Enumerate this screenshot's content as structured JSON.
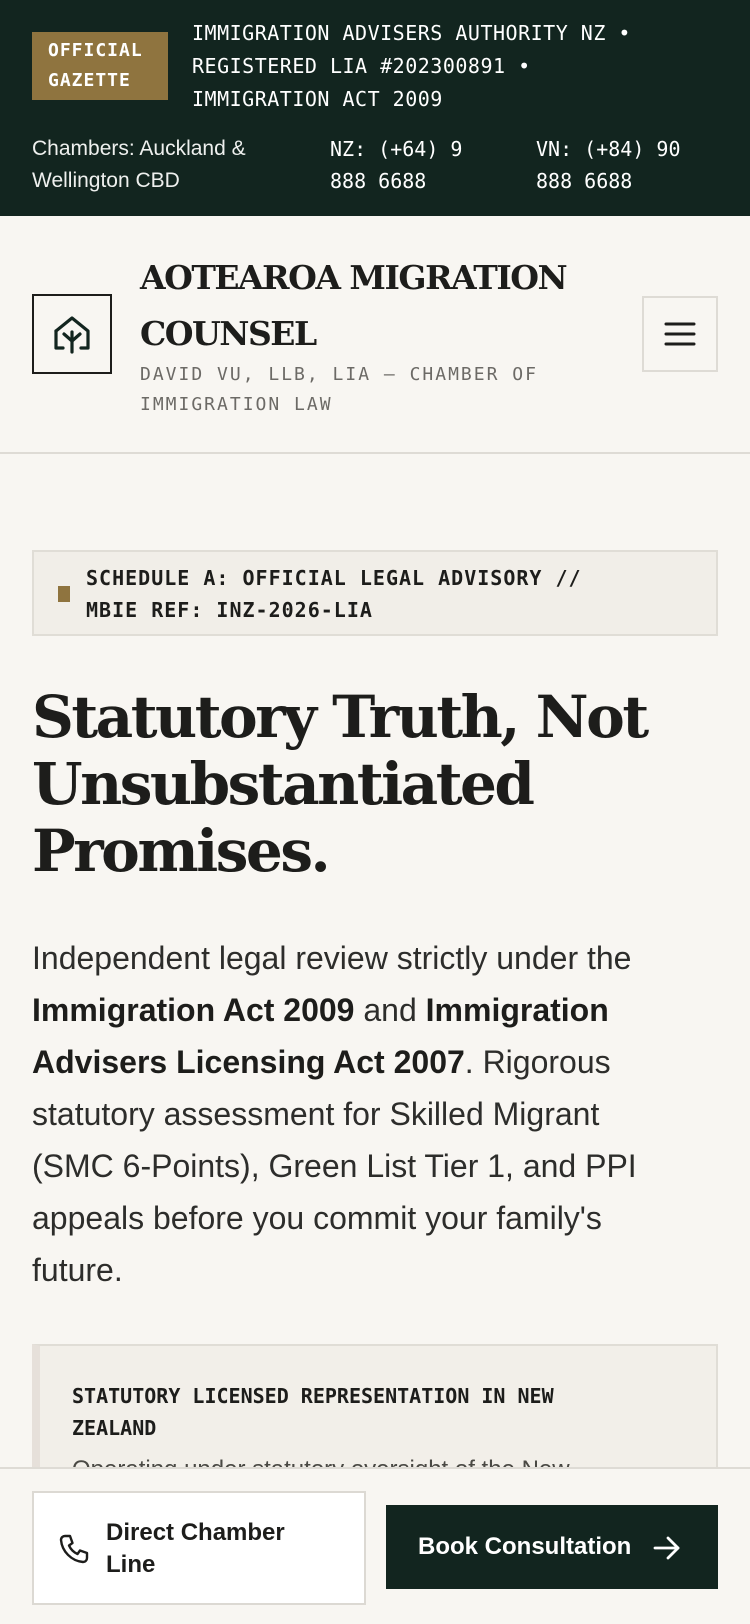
{
  "topbar": {
    "badge_line1": "OFFICIAL",
    "badge_line2": "GAZETTE",
    "authority_line1": "IMMIGRATION ADVISERS AUTHORITY NZ •",
    "authority_line2": "REGISTERED LIA #202300891 •",
    "authority_line3": "IMMIGRATION ACT 2009",
    "chambers_line1": "Chambers: Auckland &",
    "chambers_line2": "Wellington CBD",
    "phone_nz_line1": "NZ: (+64) 9",
    "phone_nz_line2": "888 6688",
    "phone_vn_line1": "VN: (+84) 90",
    "phone_vn_line2": "888 6688",
    "colors": {
      "background": "#12251f",
      "badge": "#8f743f"
    }
  },
  "header": {
    "logo_icon": "tree-house-icon",
    "brand_line1": "AOTEAROA MIGRATION",
    "brand_line2": "COUNSEL",
    "subtitle_line1": "DAVID VU, LLB, LIA — CHAMBER OF",
    "subtitle_line2": "IMMIGRATION LAW",
    "menu_icon": "hamburger-menu-icon"
  },
  "schedule": {
    "line1": "SCHEDULE A: OFFICIAL LEGAL ADVISORY //",
    "line2": "MBIE REF: INZ-2026-LIA"
  },
  "hero": {
    "headline_line1": "Statutory Truth, Not",
    "headline_line2": "Unsubstantiated",
    "headline_line3": "Promises.",
    "lead_part1": "Independent legal review strictly under the",
    "lead_bold1": "Immigration Act 2009",
    "lead_part2": " and ",
    "lead_bold2a": "Immigration",
    "lead_bold2b": "Advisers Licensing Act 2007",
    "lead_part3a": ". Rigorous",
    "lead_part3b": "statutory assessment for Skilled Migrant",
    "lead_part3c": "(SMC 6-Points), Green List Tier 1, and PPI",
    "lead_part3d": "appeals before you commit your family's",
    "lead_part3e": "future."
  },
  "statutory_box": {
    "title_line1": "STATUTORY LICENSED REPRESENTATION IN NEW",
    "title_line2": "ZEALAND",
    "body": "Operating under statutory oversight of the New"
  },
  "actions": {
    "direct_icon": "phone-icon",
    "direct_line1": "Direct Chamber",
    "direct_line2": "Line",
    "book_label": "Book Consultation",
    "book_icon": "arrow-right-icon"
  }
}
